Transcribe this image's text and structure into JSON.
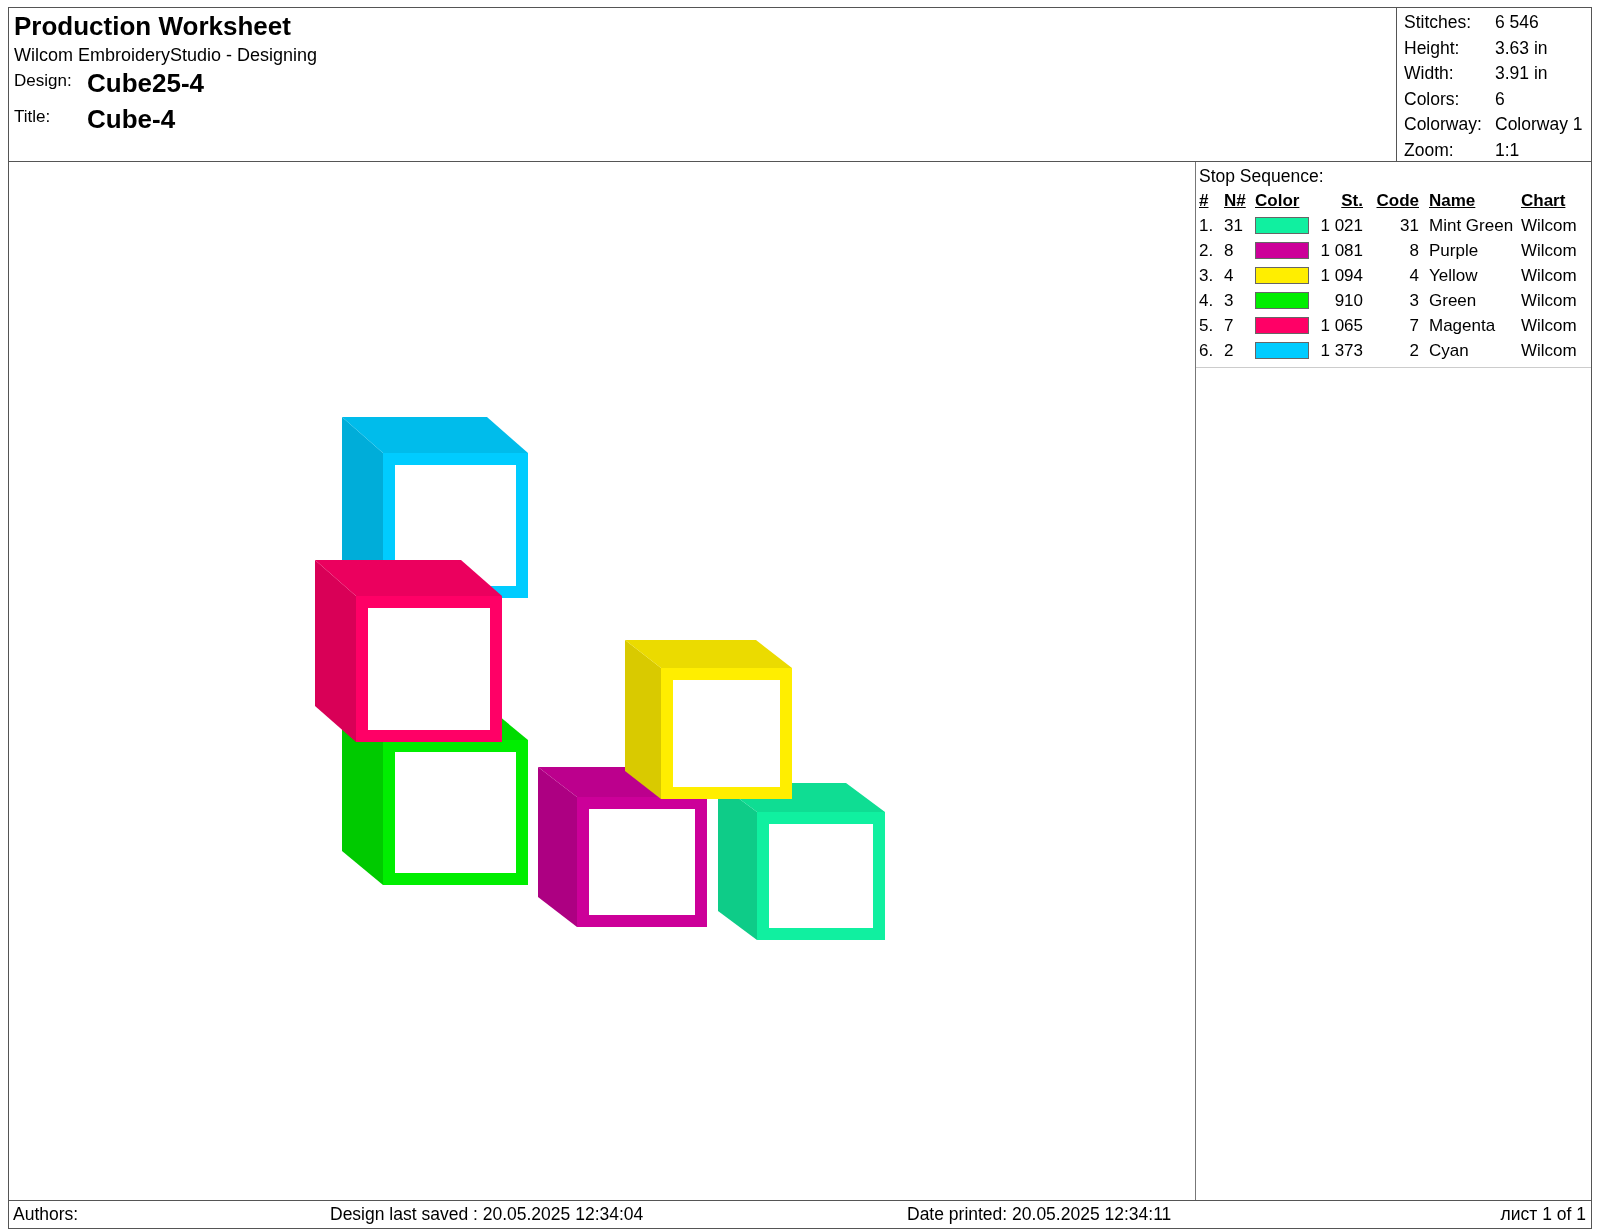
{
  "header": {
    "title": "Production Worksheet",
    "subtitle": "Wilcom EmbroideryStudio - Designing",
    "fields": [
      {
        "label": "Design:",
        "value": "Cube25-4"
      },
      {
        "label": "Title:",
        "value": "Cube-4"
      }
    ]
  },
  "summary": [
    {
      "label": "Stitches:",
      "value": "6 546"
    },
    {
      "label": "Height:",
      "value": "3.63 in"
    },
    {
      "label": "Width:",
      "value": "3.91 in"
    },
    {
      "label": "Colors:",
      "value": "6"
    },
    {
      "label": "Colorway:",
      "value": "Colorway 1"
    },
    {
      "label": "Zoom:",
      "value": "1:1"
    }
  ],
  "stop_sequence": {
    "title": "Stop Sequence:",
    "columns": [
      "#",
      "N#",
      "Color",
      "St.",
      "Code",
      "Name",
      "Chart"
    ],
    "rows": [
      {
        "index": "1.",
        "n": "31",
        "color": "#10f0a0",
        "stitches": "1 021",
        "code": "31",
        "name": "Mint Green",
        "chart": "Wilcom"
      },
      {
        "index": "2.",
        "n": "8",
        "color": "#cc0099",
        "stitches": "1 081",
        "code": "8",
        "name": "Purple",
        "chart": "Wilcom"
      },
      {
        "index": "3.",
        "n": "4",
        "color": "#ffee00",
        "stitches": "1 094",
        "code": "4",
        "name": "Yellow",
        "chart": "Wilcom"
      },
      {
        "index": "4.",
        "n": "3",
        "color": "#00ee00",
        "stitches": "910",
        "code": "3",
        "name": "Green",
        "chart": "Wilcom"
      },
      {
        "index": "5.",
        "n": "7",
        "color": "#ff0066",
        "stitches": "1 065",
        "code": "7",
        "name": "Magenta",
        "chart": "Wilcom"
      },
      {
        "index": "6.",
        "n": "2",
        "color": "#00ccff",
        "stitches": "1 373",
        "code": "2",
        "name": "Cyan",
        "chart": "Wilcom"
      }
    ]
  },
  "footer": {
    "authors": "Authors:",
    "saved": "Design last saved : 20.05.2025 12:34:04",
    "printed": "Date printed: 20.05.2025 12:34:11",
    "page": "лист 1 of 1"
  }
}
